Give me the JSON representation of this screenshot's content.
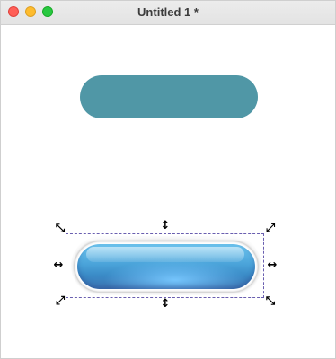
{
  "window": {
    "title": "Untitled 1 *"
  },
  "icons": {
    "close": "close-icon",
    "minimize": "minimize-icon",
    "maximize": "maximize-icon",
    "handle_nw": "resize-arrow-diagonal-nw-icon",
    "handle_n": "resize-arrow-vertical-icon",
    "handle_ne": "resize-arrow-diagonal-ne-icon",
    "handle_w": "resize-arrow-horizontal-icon",
    "handle_e": "resize-arrow-horizontal-icon",
    "handle_sw": "resize-arrow-diagonal-sw-icon",
    "handle_s": "resize-arrow-vertical-icon",
    "handle_se": "resize-arrow-diagonal-se-icon"
  },
  "colors": {
    "close": "#ff5f57",
    "minimize": "#febc2e",
    "maximize": "#28c840",
    "flat_pill": "#5097a6",
    "glossy_button_top": "#6ec5ef",
    "glossy_button_bottom": "#3f76b4",
    "selection_outline": "#6a5fb0"
  }
}
